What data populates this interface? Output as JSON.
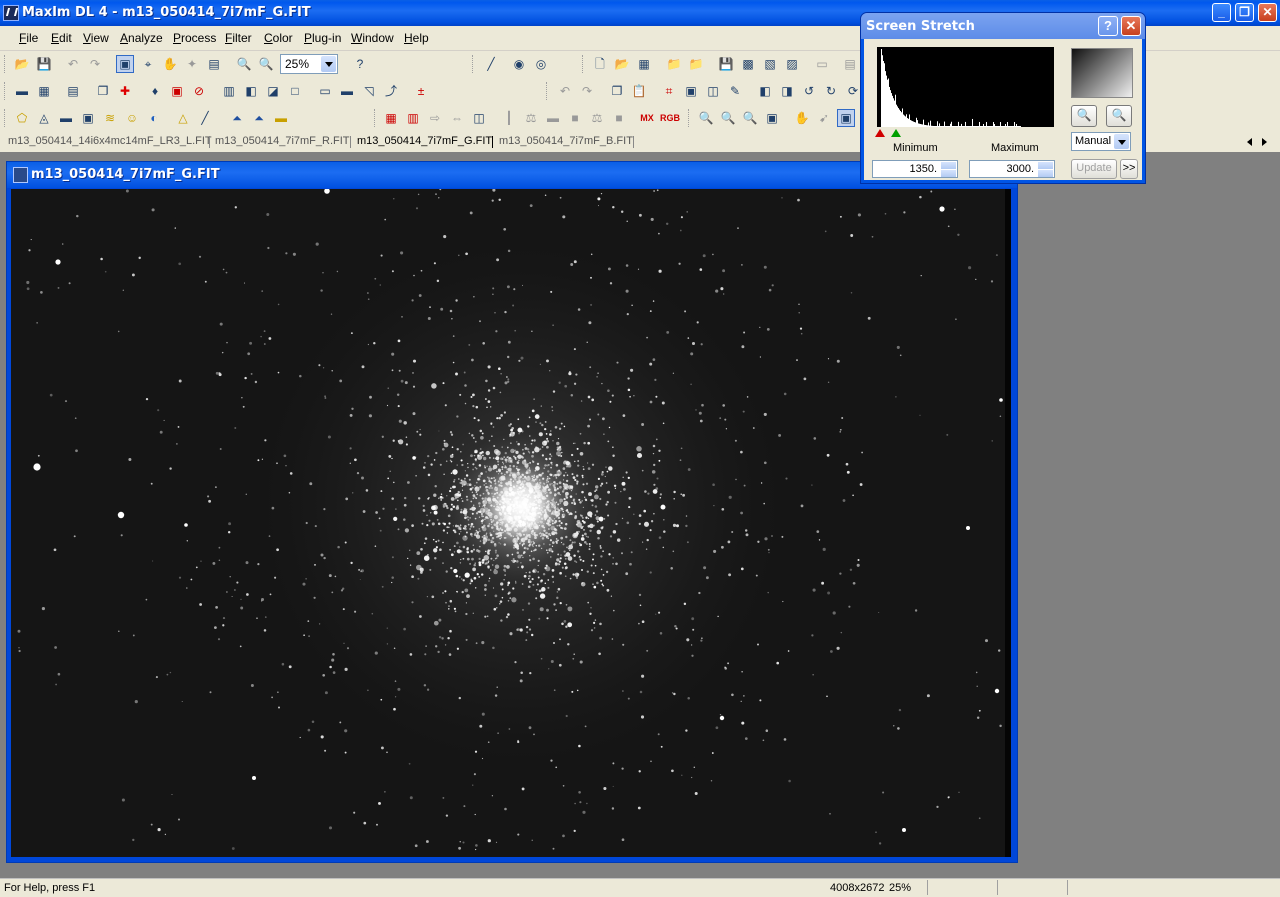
{
  "app": {
    "title": "MaxIm DL 4 - m13_050414_7i7mF_G.FIT",
    "caption_minimize": "_",
    "caption_restore": "❐",
    "caption_close": "✕"
  },
  "menu": [
    "File",
    "Edit",
    "View",
    "Analyze",
    "Process",
    "Filter",
    "Color",
    "Plug-in",
    "Window",
    "Help"
  ],
  "toolbar": {
    "zoom_value": "25%",
    "text_buttons": [
      "MX",
      "RGB"
    ]
  },
  "tabs": [
    {
      "label": "m13_050414_14i6x4mc14mF_LR3_L.FIT",
      "selected": false
    },
    {
      "label": "m13_050414_7i7mF_R.FIT",
      "selected": false
    },
    {
      "label": "m13_050414_7i7mF_G.FIT",
      "selected": true
    },
    {
      "label": "m13_050414_7i7mF_B.FIT",
      "selected": false
    }
  ],
  "image_window": {
    "title": "m13_050414_7i7mF_G.FIT"
  },
  "stretch_dialog": {
    "title": "Screen Stretch",
    "help_label": "?",
    "close_label": "✕",
    "minimum_label": "Minimum",
    "maximum_label": "Maximum",
    "minimum_value": "1350.",
    "maximum_value": "3000.",
    "mode": "Manual",
    "update_label": "Update",
    "expand_label": ">>"
  },
  "status": {
    "help": "For Help, press F1",
    "dimensions": "4008x2672",
    "zoom": "25%"
  },
  "colors": {
    "titlebar": "#0054E3",
    "chrome": "#ECE9D8",
    "mdi_background": "#808080",
    "image_background": "#141414"
  }
}
